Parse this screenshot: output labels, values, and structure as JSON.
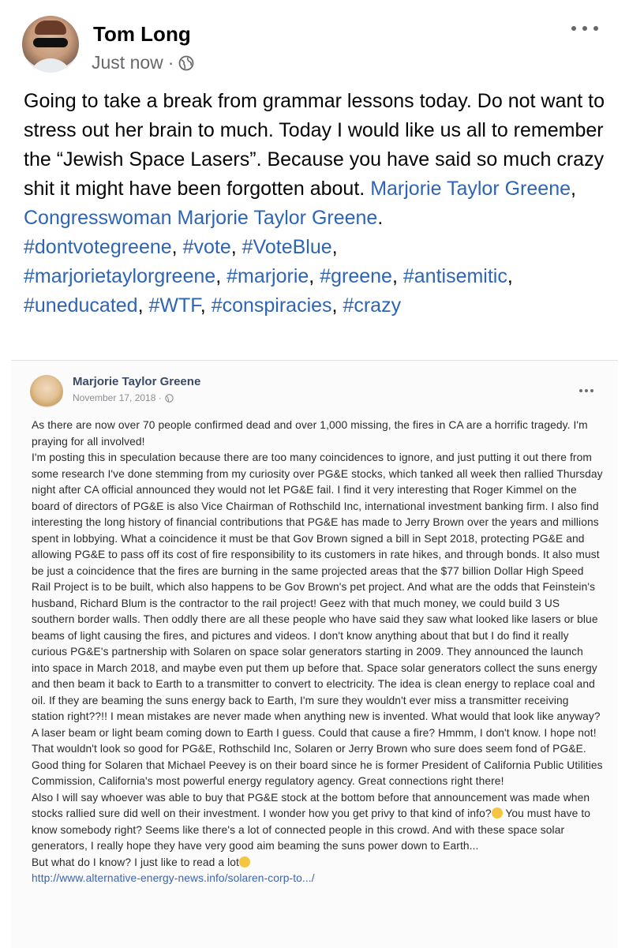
{
  "author": {
    "name": "Tom Long",
    "time": "Just now",
    "separator": "·"
  },
  "post": {
    "text_intro": "Going to take a break from grammar lessons today. Do not want to stress out her brain to much. Today I would like us all to remember the “Jewish Space Lasers”. Because you have said so much crazy shit it might have been forgotten about. ",
    "mention_1": "Marjorie Taylor Greene",
    "comma": ", ",
    "mention_2": "Congresswoman Marjorie Taylor Greene",
    "period": ".",
    "hashtags": [
      "#dontvotegreene",
      "#vote",
      "#VoteBlue",
      "#marjorietaylorgreene",
      "#marjorie",
      "#greene",
      "#antisemitic",
      "#uneducated",
      "#WTF",
      "#conspiracies",
      "#crazy"
    ]
  },
  "embedded_post": {
    "author": "Marjorie Taylor Greene",
    "date": "November 17, 2018 ·",
    "paragraph_1": "As there are now over 70 people confirmed dead and over 1,000 missing, the fires in CA are a horrific tragedy. I'm praying for all involved!",
    "paragraph_2": "I'm posting this in speculation because there are too many coincidences to ignore, and just putting it out there from some research I've done stemming from my curiosity over PG&E stocks, which tanked all week then rallied Thursday night after CA official announced they would not let PG&E fail. I find it very interesting that Roger Kimmel on the board of directors of PG&E is also Vice Chairman of Rothschild Inc, international investment banking firm. I also find interesting the long history of financial contributions that PG&E has made to Jerry Brown over the years and millions spent in lobbying. What a coincidence it must be that Gov Brown signed a bill in Sept 2018, protecting PG&E and allowing PG&E to pass off its cost of fire responsibility to its customers in rate hikes, and through bonds. It also must be just a coincidence that the fires are burning in the same projected areas that the $77 billion Dollar High Speed Rail Project is to be built, which also happens to be Gov Brown's pet project. And what are the odds that Feinstein's husband, Richard Blum is the contractor to the rail project! Geez with that much money, we could build 3 US southern border walls. Then oddly there are all these people who have said they saw what looked like lasers or blue beams of light causing the fires, and pictures and videos. I don't know anything about that but I do find it really curious PG&E's partnership with Solaren on space solar generators starting in 2009. They announced the launch into space in March 2018, and maybe even put them up before that. Space solar generators collect the suns energy and then beam it back to Earth to a transmitter to convert to electricity. The idea is clean energy to replace coal and oil. If they are beaming the suns energy back to Earth, I'm sure they wouldn't ever miss a transmitter receiving station right??!! I mean mistakes are never made when anything new is invented. What would that look like anyway? A laser beam or light beam coming down to Earth I guess. Could that cause a fire? Hmmm, I don't know. I hope not! That wouldn't look so good for PG&E, Rothschild Inc, Solaren or Jerry Brown who sure does seem fond of PG&E. Good thing for Solaren that Michael Peevey is on their board since he is former President of California Public Utilities Commission, California's most powerful energy regulatory agency. Great connections right there!",
    "paragraph_3a": "Also I will say whoever was able to buy that PG&E stock at the bottom before that announcement was made when stocks rallied sure did well on their investment. I wonder how you get privy to that kind of info?",
    "paragraph_3b": " You must have to know somebody right? Seems like there's a lot of connected people in this crowd. And with these space solar generators, I really hope they have very good aim beaming the suns power down to Earth...",
    "paragraph_4": "But what do I know? I just like to read a lot",
    "link": "http://www.alternative-energy-news.info/solaren-corp-to.../",
    "emoji_1": "face-emoji-icon",
    "emoji_2": "face-emoji-icon"
  },
  "colors": {
    "link": "#2e64b5",
    "meta_gray": "#65676b",
    "text": "#050505"
  }
}
